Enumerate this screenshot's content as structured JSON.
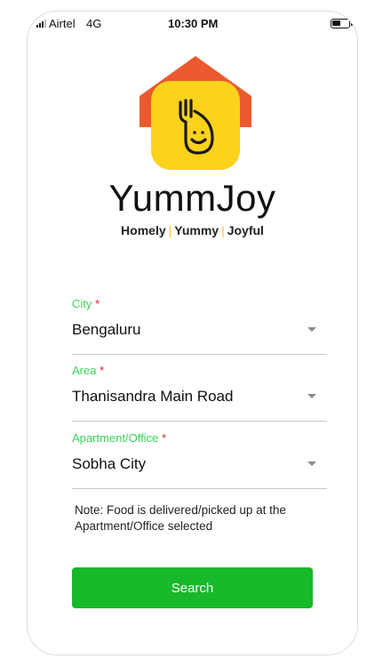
{
  "status_bar": {
    "carrier": "Airtel",
    "network": "4G",
    "time": "10:30 PM"
  },
  "brand": {
    "name": "YummJoy",
    "tagline": {
      "part1": "Homely",
      "separator": "|",
      "part2": "Yummy",
      "part3": "Joyful"
    },
    "colors": {
      "roof": "#ea5a2e",
      "tile": "#fcd21c",
      "separator": "#f5c518"
    }
  },
  "form": {
    "required_marker": "*",
    "city": {
      "label": "City",
      "value": "Bengaluru"
    },
    "area": {
      "label": "Area",
      "value": "Thanisandra Main Road"
    },
    "apartment": {
      "label": "Apartment/Office",
      "value": "Sobha City"
    },
    "note": "Note: Food is delivered/picked up at the Apartment/Office selected",
    "search_label": "Search"
  },
  "colors": {
    "accent": "#17b82a",
    "label": "#3ed15a",
    "required": "#e02020"
  }
}
